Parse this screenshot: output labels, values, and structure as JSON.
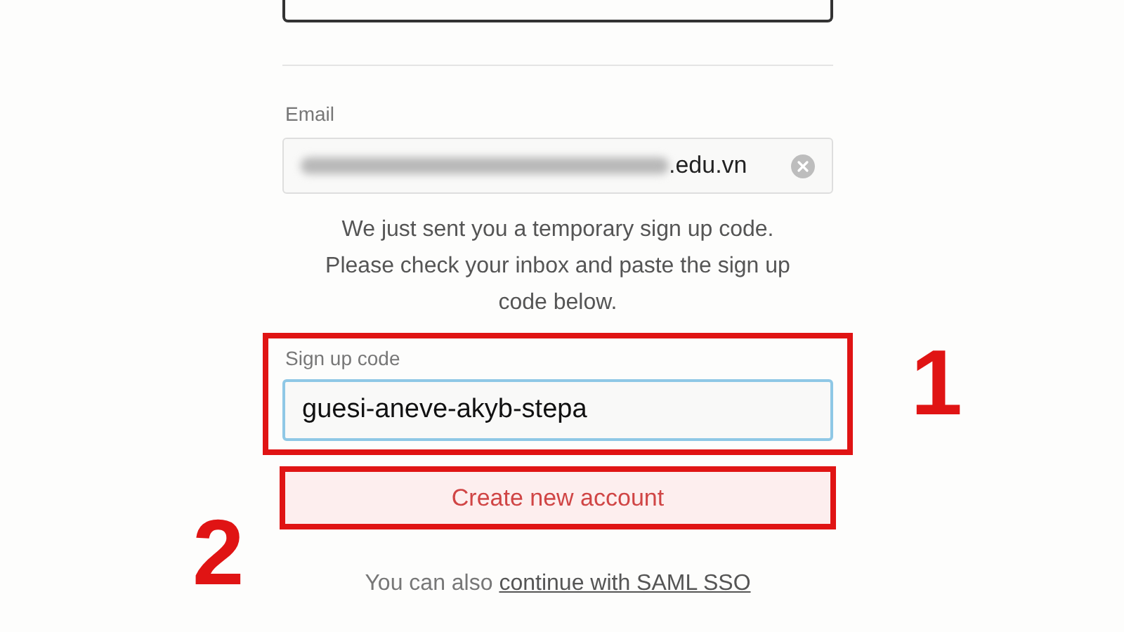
{
  "email": {
    "label": "Email",
    "value": ".edu.vn",
    "redacted": true
  },
  "notice": "We just sent you a temporary sign up code. Please check your inbox and paste the sign up code below.",
  "code": {
    "label": "Sign up code",
    "value": "guesi-aneve-akyb-stepa",
    "focused": true,
    "annotation": "1"
  },
  "submit": {
    "label": "Create new account",
    "annotation": "2"
  },
  "footer": {
    "text": "You can also",
    "link": "continue with SAML SSO"
  }
}
